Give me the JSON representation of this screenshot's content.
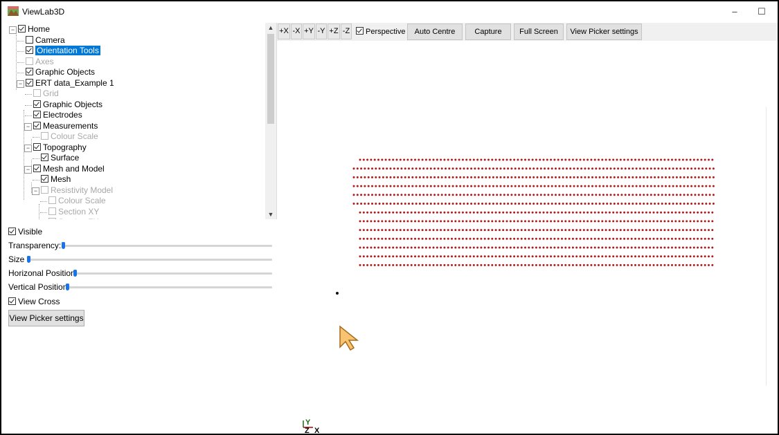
{
  "window": {
    "title": "ViewLab3D",
    "minimize_glyph": "–",
    "maximize_glyph": "☐"
  },
  "tree": {
    "items": [
      {
        "label": "Home",
        "checked": true,
        "disabled": false,
        "expanded": true
      },
      {
        "label": "Camera",
        "checked": false,
        "disabled": false
      },
      {
        "label": "Orientation Tools",
        "checked": true,
        "disabled": false,
        "selected": true
      },
      {
        "label": "Axes",
        "checked": false,
        "disabled": true
      },
      {
        "label": "Graphic Objects",
        "checked": true,
        "disabled": false
      },
      {
        "label": "ERT data_Example 1",
        "checked": true,
        "disabled": false,
        "expanded": true
      },
      {
        "label": "Grid",
        "checked": false,
        "disabled": true
      },
      {
        "label": "Graphic Objects",
        "checked": true,
        "disabled": false
      },
      {
        "label": "Electrodes",
        "checked": true,
        "disabled": false
      },
      {
        "label": "Measurements",
        "checked": true,
        "disabled": false,
        "expanded": true
      },
      {
        "label": "Colour Scale",
        "checked": false,
        "disabled": true
      },
      {
        "label": "Topography",
        "checked": true,
        "disabled": false,
        "expanded": true
      },
      {
        "label": "Surface",
        "checked": true,
        "disabled": false
      },
      {
        "label": "Mesh and Model",
        "checked": true,
        "disabled": false,
        "expanded": true
      },
      {
        "label": "Mesh",
        "checked": true,
        "disabled": false
      },
      {
        "label": "Resistivity Model",
        "checked": false,
        "disabled": true,
        "expanded": true
      },
      {
        "label": "Colour Scale",
        "checked": false,
        "disabled": true
      },
      {
        "label": "Section XY",
        "checked": false,
        "disabled": true
      },
      {
        "label": "Section ZX",
        "checked": false,
        "disabled": true
      }
    ]
  },
  "properties": {
    "visible_label": "Visible",
    "visible_checked": true,
    "transparency_label": "Transparency:",
    "size_label": "Size",
    "horizontal_label": "Horizonal Position",
    "vertical_label": "Vertical Position",
    "view_cross_label": "View Cross",
    "view_cross_checked": true,
    "picker_button": "View Picker settings"
  },
  "toolbar": {
    "axis_buttons": [
      "+X",
      "-X",
      "+Y",
      "-Y",
      "+Z",
      "-Z"
    ],
    "perspective_label": "Perspective",
    "perspective_checked": true,
    "auto_centre": "Auto Centre",
    "capture": "Capture",
    "full_screen": "Full Screen",
    "view_picker": "View Picker settings"
  },
  "viewer": {
    "point_color": "#b01c1c",
    "orientation_axes": {
      "y": "Y",
      "z": "Z",
      "x": "X"
    },
    "pointer_color": "#f8c471"
  }
}
